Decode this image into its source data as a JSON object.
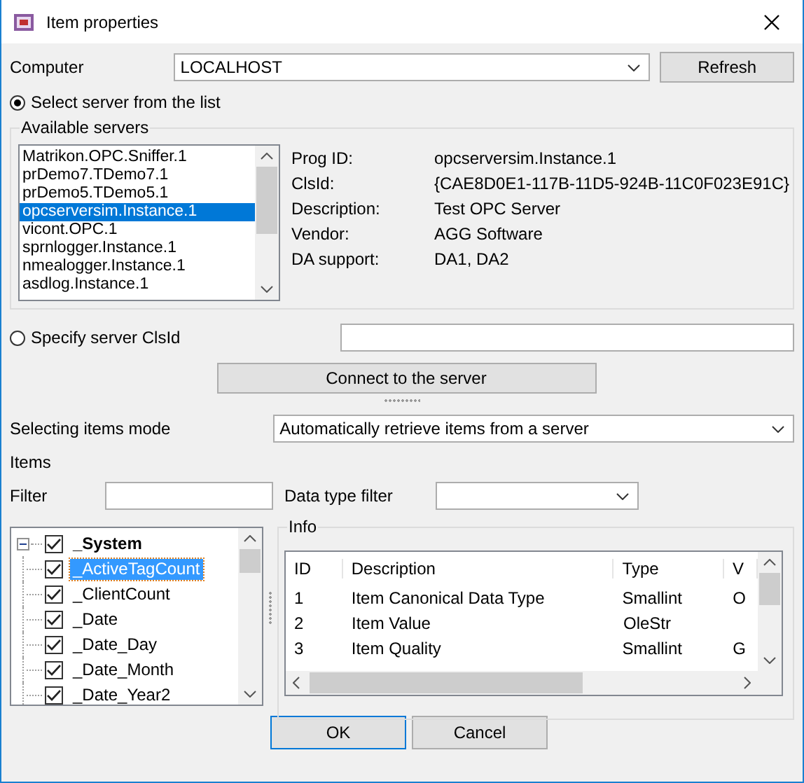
{
  "window": {
    "title": "Item properties"
  },
  "computer": {
    "label": "Computer",
    "value": "LOCALHOST",
    "refresh": "Refresh"
  },
  "server_mode": [
    {
      "label": "Select server from the list",
      "selected": true
    },
    {
      "label": "Specify server ClsId",
      "selected": false
    }
  ],
  "available_servers": {
    "title": "Available servers",
    "items": [
      {
        "label": "Matrikon.OPC.Sniffer.1",
        "selected": false
      },
      {
        "label": "prDemo7.TDemo7.1",
        "selected": false
      },
      {
        "label": "prDemo5.TDemo5.1",
        "selected": false
      },
      {
        "label": "opcserversim.Instance.1",
        "selected": true
      },
      {
        "label": "vicont.OPC.1",
        "selected": false
      },
      {
        "label": "sprnlogger.Instance.1",
        "selected": false
      },
      {
        "label": "nmealogger.Instance.1",
        "selected": false
      },
      {
        "label": "asdlog.Instance.1",
        "selected": false
      }
    ]
  },
  "server_info": [
    {
      "label": "Prog ID:",
      "value": "opcserversim.Instance.1"
    },
    {
      "label": "ClsId:",
      "value": "{CAE8D0E1-117B-11D5-924B-11C0F023E91C}"
    },
    {
      "label": "Description:",
      "value": "Test OPC Server"
    },
    {
      "label": "Vendor:",
      "value": "AGG Software"
    },
    {
      "label": "DA support:",
      "value": "DA1, DA2"
    }
  ],
  "connect": "Connect to the server",
  "selecting_mode": {
    "label": "Selecting items mode",
    "value": "Automatically retrieve items from a server"
  },
  "items_label": "Items",
  "filter": {
    "label": "Filter"
  },
  "data_type_filter": {
    "label": "Data type filter"
  },
  "tree": {
    "label": "_System",
    "checked": true,
    "expanded": true,
    "children": [
      {
        "label": "_ActiveTagCount",
        "checked": true,
        "selected": true
      },
      {
        "label": "_ClientCount",
        "checked": true,
        "selected": false
      },
      {
        "label": "_Date",
        "checked": true,
        "selected": false
      },
      {
        "label": "_Date_Day",
        "checked": true,
        "selected": false
      },
      {
        "label": "_Date_Month",
        "checked": true,
        "selected": false
      },
      {
        "label": "_Date_Year2",
        "checked": true,
        "selected": false
      }
    ]
  },
  "info": {
    "title": "Info",
    "columns": [
      "ID",
      "Description",
      "Type",
      "V"
    ],
    "rows": [
      {
        "id": "1",
        "description": "Item Canonical Data Type",
        "type": "Smallint",
        "column_4": "O"
      },
      {
        "id": "2",
        "description": "Item Value",
        "type": "OleStr"
      },
      {
        "id": "3",
        "description": "Item Quality",
        "type": "Smallint",
        "column_4": "G"
      }
    ]
  },
  "buttons": [
    "OK",
    "Cancel"
  ]
}
